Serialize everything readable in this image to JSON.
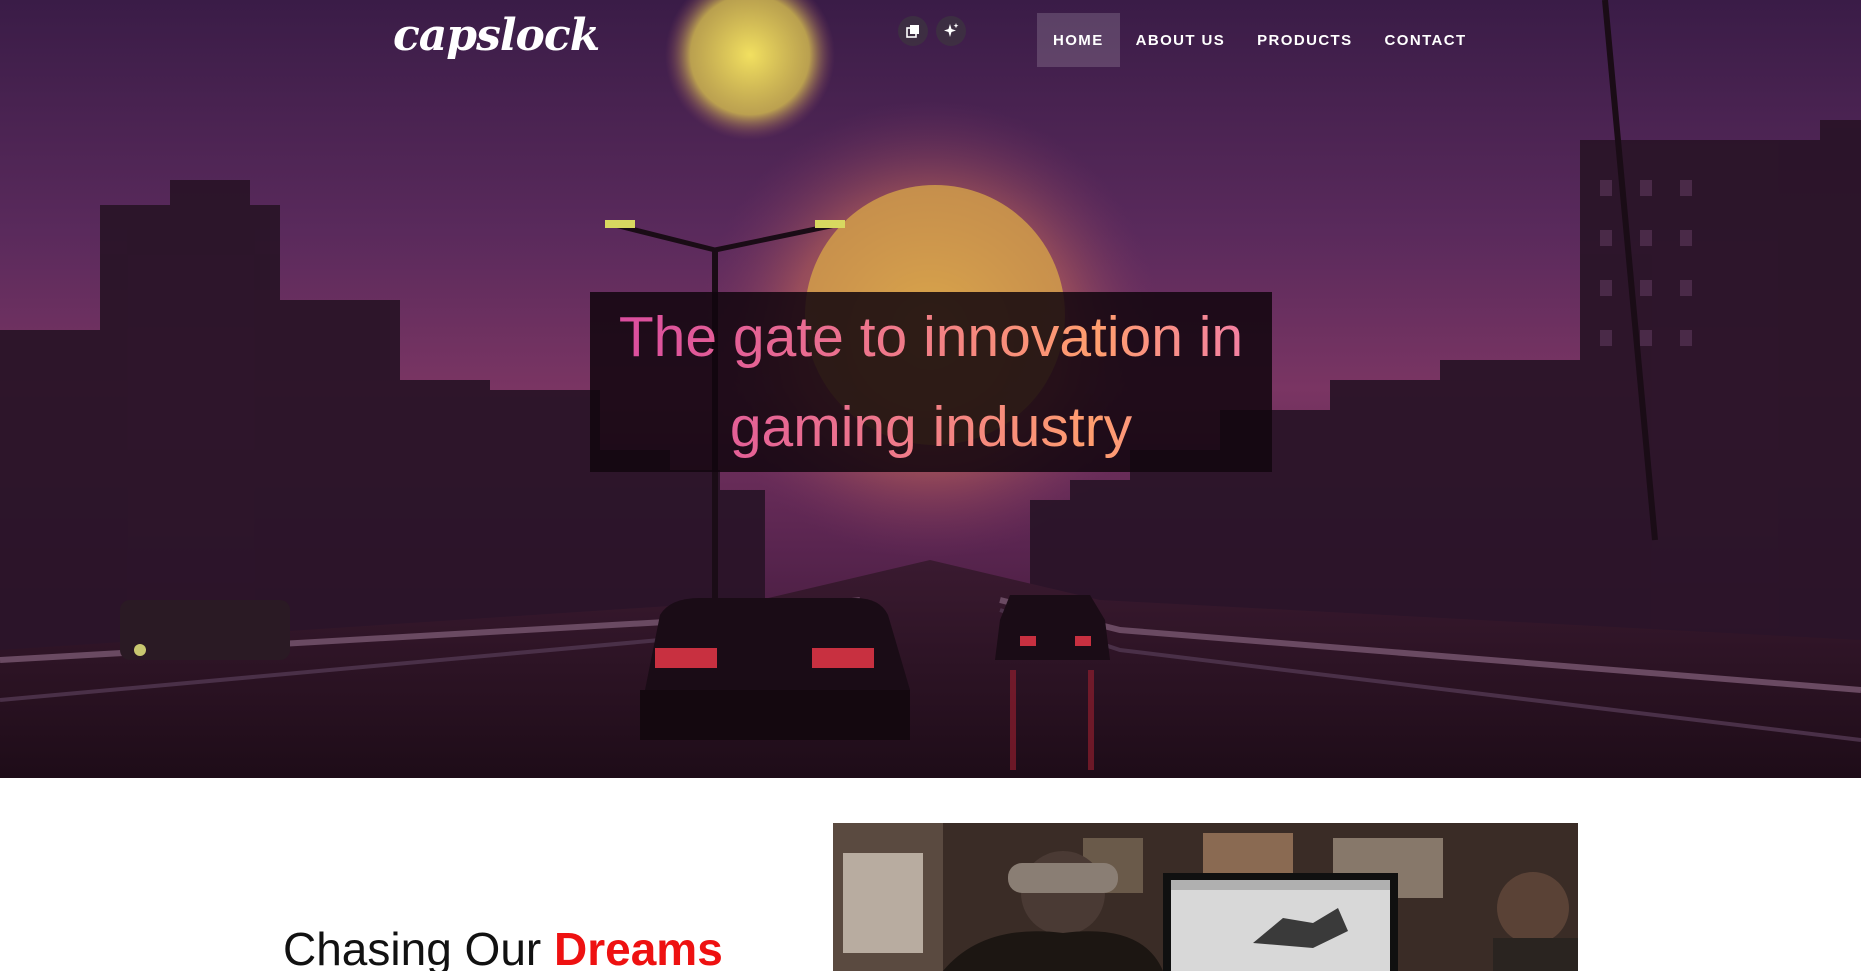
{
  "header": {
    "logo": "capslock",
    "tool_icons": [
      "copy-icon",
      "sparkle-icon"
    ],
    "nav": [
      {
        "label": "HOME",
        "active": true
      },
      {
        "label": "ABOUT US",
        "active": false
      },
      {
        "label": "PRODUCTS",
        "active": false
      },
      {
        "label": "CONTACT",
        "active": false
      }
    ]
  },
  "hero": {
    "headline_line1": "The gate to innovation in",
    "headline_line2": "gaming industry"
  },
  "section": {
    "heading_plain": "Chasing Our ",
    "heading_accent": "Dreams"
  },
  "colors": {
    "accent": "#ee1111",
    "headline_gradient_start": "#d94aa0",
    "headline_gradient_end": "#ff9e6e",
    "hero_overlay": "#3a1c47"
  }
}
